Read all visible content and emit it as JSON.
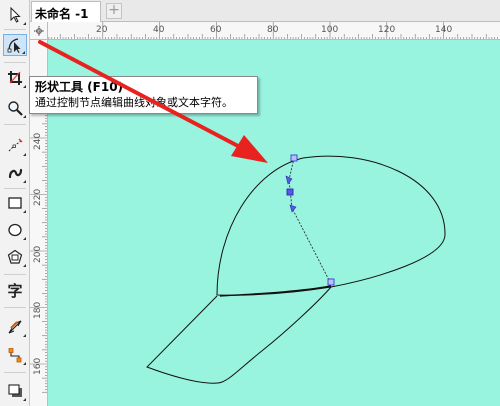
{
  "document": {
    "tab_title": "未命名 -1",
    "add_tab_symbol": "+"
  },
  "tooltip": {
    "title": "形状工具 (F10)",
    "description": "通过控制节点编辑曲线对象或文本字符。"
  },
  "toolbox": {
    "tools": [
      {
        "name": "pick-tool",
        "icon": "pointer-arrow-icon",
        "active": false
      },
      {
        "name": "shape-tool",
        "icon": "shape-node-edit-icon",
        "active": true
      },
      {
        "name": "crop-tool",
        "icon": "crop-icon",
        "active": false
      },
      {
        "name": "zoom-tool",
        "icon": "magnifier-icon",
        "active": false
      },
      {
        "name": "freehand-tool",
        "icon": "freehand-curve-icon",
        "active": false
      },
      {
        "name": "artistic-media-tool",
        "icon": "artistic-media-icon",
        "active": false
      },
      {
        "name": "rectangle-tool",
        "icon": "rectangle-icon",
        "active": false
      },
      {
        "name": "ellipse-tool",
        "icon": "ellipse-icon",
        "active": false
      },
      {
        "name": "polygon-tool",
        "icon": "polygon-icon",
        "active": false
      },
      {
        "name": "text-tool",
        "icon": "text-icon",
        "glyph": "字",
        "active": false
      },
      {
        "name": "dimension-tool",
        "icon": "parallel-dimension-icon",
        "active": false
      },
      {
        "name": "connector-tool",
        "icon": "connector-icon",
        "active": false
      },
      {
        "name": "drop-shadow-tool",
        "icon": "drop-shadow-icon",
        "active": false
      }
    ]
  },
  "rulers": {
    "horizontal_labels": [
      "20",
      "40",
      "60",
      "80",
      "100",
      "120",
      "140"
    ],
    "vertical_labels": [
      "240",
      "220",
      "200",
      "180",
      "160"
    ]
  },
  "colors": {
    "canvas": "#98f3df",
    "annotation_arrow": "#e8231f",
    "node": "#5a5ae0",
    "curve": "#111111"
  }
}
